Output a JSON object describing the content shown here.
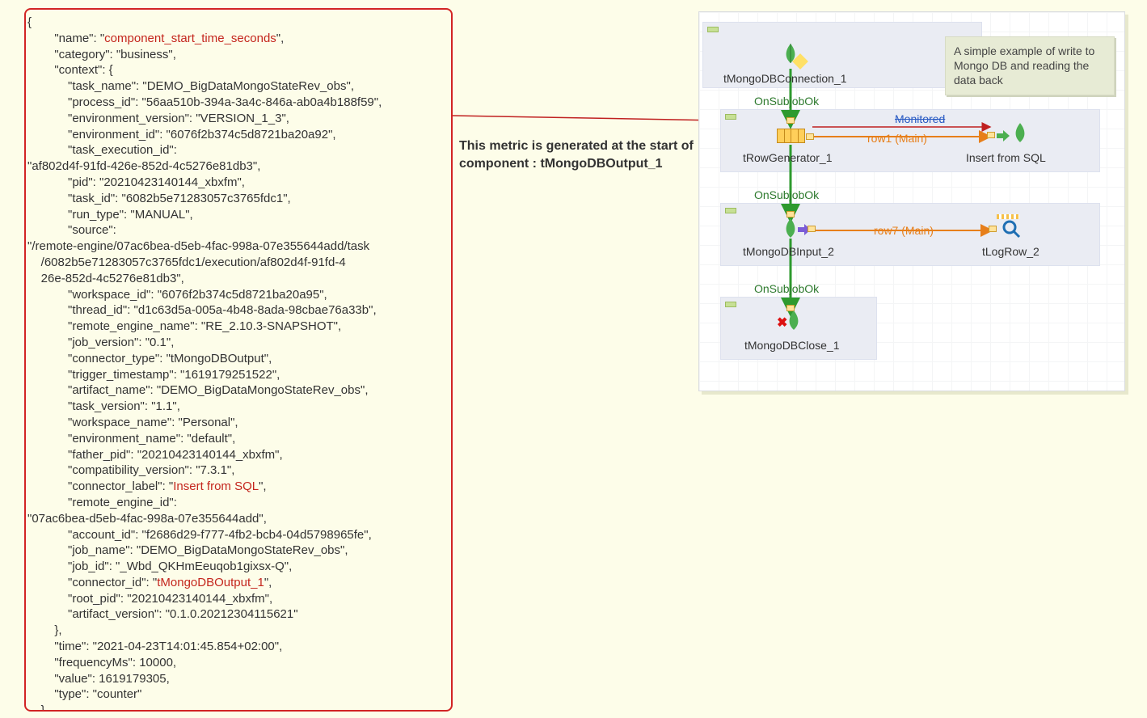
{
  "json_payload": {
    "fields": [
      {
        "i": 0,
        "t": "{"
      },
      {
        "i": 2,
        "t": "\"name\": \"",
        "v": "component_start_time_seconds",
        "hl": true,
        "a": "\","
      },
      {
        "i": 2,
        "t": "\"category\": \"business\","
      },
      {
        "i": 2,
        "t": "\"context\": {"
      },
      {
        "i": 3,
        "t": "\"task_name\": \"DEMO_BigDataMongoStateRev_obs\","
      },
      {
        "i": 3,
        "t": "\"process_id\": \"56aa510b-394a-3a4c-846a-ab0a4b188f59\","
      },
      {
        "i": 3,
        "t": "\"environment_version\": \"VERSION_1_3\","
      },
      {
        "i": 3,
        "t": "\"environment_id\": \"6076f2b374c5d8721ba20a92\","
      },
      {
        "i": 3,
        "t": "\"task_execution_id\":"
      },
      {
        "i": 0,
        "t": "\"af802d4f-91fd-426e-852d-4c5276e81db3\","
      },
      {
        "i": 3,
        "t": "\"pid\": \"20210423140144_xbxfm\","
      },
      {
        "i": 3,
        "t": "\"task_id\": \"6082b5e71283057c3765fdc1\","
      },
      {
        "i": 3,
        "t": "\"run_type\": \"MANUAL\","
      },
      {
        "i": 3,
        "t": "\"source\":"
      },
      {
        "i": 0,
        "t": "\"/remote-engine/07ac6bea-d5eb-4fac-998a-07e355644add/task"
      },
      {
        "i": 1,
        "t": "/6082b5e71283057c3765fdc1/execution/af802d4f-91fd-4"
      },
      {
        "i": 1,
        "t": "26e-852d-4c5276e81db3\","
      },
      {
        "i": 3,
        "t": "\"workspace_id\": \"6076f2b374c5d8721ba20a95\","
      },
      {
        "i": 3,
        "t": "\"thread_id\": \"d1c63d5a-005a-4b48-8ada-98cbae76a33b\","
      },
      {
        "i": 3,
        "t": "\"remote_engine_name\": \"RE_2.10.3-SNAPSHOT\","
      },
      {
        "i": 3,
        "t": "\"job_version\": \"0.1\","
      },
      {
        "i": 3,
        "t": "\"connector_type\": \"tMongoDBOutput\","
      },
      {
        "i": 3,
        "t": "\"trigger_timestamp\": \"1619179251522\","
      },
      {
        "i": 3,
        "t": "\"artifact_name\": \"DEMO_BigDataMongoStateRev_obs\","
      },
      {
        "i": 3,
        "t": "\"task_version\": \"1.1\","
      },
      {
        "i": 3,
        "t": "\"workspace_name\": \"Personal\","
      },
      {
        "i": 3,
        "t": "\"environment_name\": \"default\","
      },
      {
        "i": 3,
        "t": "\"father_pid\": \"20210423140144_xbxfm\","
      },
      {
        "i": 3,
        "t": "\"compatibility_version\": \"7.3.1\","
      },
      {
        "i": 3,
        "t": "\"connector_label\": \"",
        "v": "Insert from SQL",
        "hl": true,
        "a": "\","
      },
      {
        "i": 3,
        "t": "\"remote_engine_id\":"
      },
      {
        "i": 0,
        "t": "\"07ac6bea-d5eb-4fac-998a-07e355644add\","
      },
      {
        "i": 3,
        "t": "\"account_id\": \"f2686d29-f777-4fb2-bcb4-04d5798965fe\","
      },
      {
        "i": 3,
        "t": "\"job_name\": \"DEMO_BigDataMongoStateRev_obs\","
      },
      {
        "i": 3,
        "t": "\"job_id\": \"_Wbd_QKHmEeuqob1gixsx-Q\","
      },
      {
        "i": 3,
        "t": "\"connector_id\": \"",
        "v": "tMongoDBOutput_1",
        "hl": true,
        "a": "\","
      },
      {
        "i": 3,
        "t": "\"root_pid\": \"20210423140144_xbxfm\","
      },
      {
        "i": 3,
        "t": "\"artifact_version\": \"0.1.0.20212304115621\""
      },
      {
        "i": 2,
        "t": "},"
      },
      {
        "i": 2,
        "t": "\"time\": \"2021-04-23T14:01:45.854+02:00\","
      },
      {
        "i": 2,
        "t": "\"frequencyMs\": 10000,"
      },
      {
        "i": 2,
        "t": "\"value\": 1619179305,"
      },
      {
        "i": 2,
        "t": "\"type\": \"counter\""
      },
      {
        "i": 1,
        "t": "}"
      }
    ]
  },
  "caption": "This metric is generated at the start of component : tMongoDBOutput_1",
  "note": "A simple example of write to Mongo DB and reading the data back",
  "components": {
    "conn": "tMongoDBConnection_1",
    "rowgen": "tRowGenerator_1",
    "output": "Insert from SQL",
    "input": "tMongoDBInput_2",
    "logrow": "tLogRow_2",
    "close": "tMongoDBClose_1"
  },
  "flows": {
    "ok1": "OnSubjobOk",
    "ok2": "OnSubjobOk",
    "ok3": "OnSubjobOk",
    "row1": "row1 (Main)",
    "row7": "row7 (Main)",
    "monitored": "Monitored"
  }
}
